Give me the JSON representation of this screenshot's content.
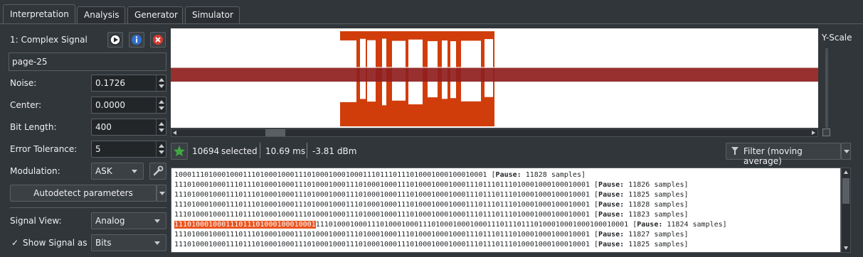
{
  "tabs": [
    {
      "label": "Interpretation",
      "active": true
    },
    {
      "label": "Analysis"
    },
    {
      "label": "Generator"
    },
    {
      "label": "Simulator"
    }
  ],
  "signal": {
    "index_name": "1:  Complex Signal",
    "name_field": "page-25"
  },
  "fields": {
    "noise_label": "Noise:",
    "noise_value": "0.1726",
    "center_label": "Center:",
    "center_value": "0.0000",
    "bitlength_label": "Bit Length:",
    "bitlength_value": "400",
    "errtol_label": "Error Tolerance:",
    "errtol_value": "5",
    "modulation_label": "Modulation:",
    "modulation_value": "ASK"
  },
  "autodetect_label": "Autodetect parameters",
  "signal_view_label": "Signal View:",
  "signal_view_value": "Analog",
  "show_signal_label": "Show Signal as",
  "show_signal_value": "Bits",
  "show_signal_checked": "✓",
  "yscale_label": "Y-Scale",
  "status": {
    "selected_count": "10694",
    "selected_word": "selected",
    "duration": "10.69 ms",
    "power": "-3.81 dBm",
    "filter_label": "Filter (moving average)"
  },
  "bits_lines": [
    {
      "bits": "1000111010001000111010001000111010001000100011101110111010001000100010001",
      "pause_label": "Pause:",
      "pause_text": "11828 samples"
    },
    {
      "bits": "1110100010001110111010001000111010001000111010001000111010001000100011101110111010001000100010001",
      "pause_label": "Pause:",
      "pause_text": "11826 samples"
    },
    {
      "bits": "1110100010001110111010001000111010001000111010001000111010001000100011101110111010001000100010001",
      "pause_label": "Pause:",
      "pause_text": "11825 samples"
    },
    {
      "bits": "1110100010001110111010001000111010001000111010001000111010001000100011101110111010001000100010001",
      "pause_label": "Pause:",
      "pause_text": "11828 samples"
    },
    {
      "bits": "1110100010001110111010001000111010001000111010001000111010001000100011101110111010001000100010001",
      "pause_label": "Pause:",
      "pause_text": "11823 samples"
    },
    {
      "hl": "111010001000111011101000100010001",
      "bits": "1110100010001110100010001110100010001000111011101110100010001000100010001",
      "pause_label": "Pause:",
      "pause_text": "11824 samples"
    },
    {
      "bits": "1110100010001110111010001000111010001000111010001000111010001000100011101110111010001000100010001",
      "pause_label": "Pause:",
      "pause_text": "11827 samples"
    },
    {
      "bits": "1110100010001110111010001000111010001000111010001000111010001000100011101110111010001000100010001",
      "pause_label": "Pause:",
      "pause_text": "11825 samples"
    }
  ],
  "colors": {
    "selection": "#d13d0a",
    "signal_band": "#8f1e1e",
    "highlight": "#e8541f"
  }
}
